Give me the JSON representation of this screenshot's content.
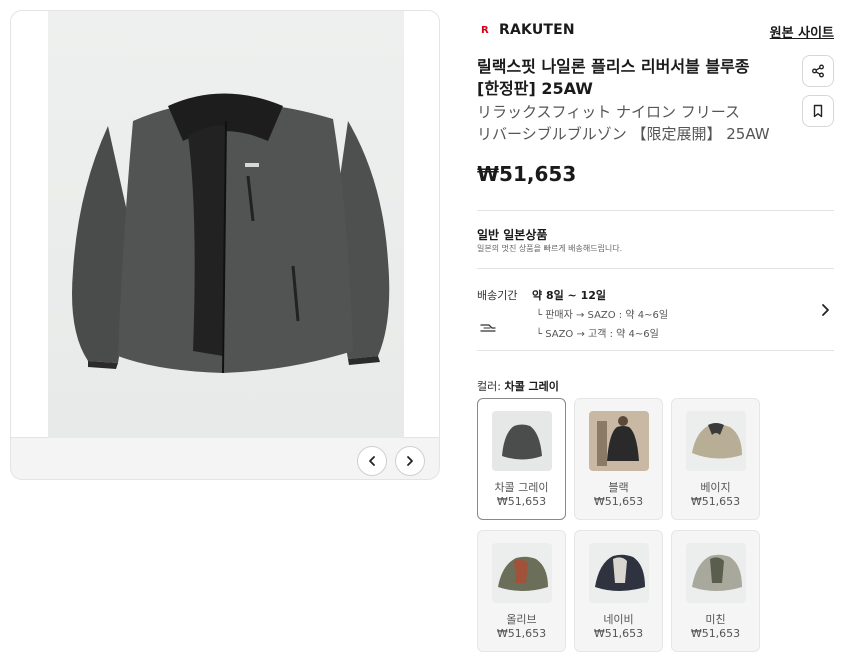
{
  "gallery": {
    "prev_icon": "chevron-left-icon",
    "next_icon": "chevron-right-icon"
  },
  "product": {
    "brand": "RAKUTEN",
    "brand_logo": "R",
    "brand_color": "#d0021b",
    "origin_link": "원본 사이트",
    "title_line1": "릴랙스핏 나일론 플리스 리버서블 블루종",
    "title_line2": "[한정판] 25AW",
    "subtitle_line1": "リラックスフィット ナイロン フリース",
    "subtitle_line2": "リバーシブルブルゾン 【限定展開】 25AW",
    "price": "₩51,653"
  },
  "seller": {
    "type_title": "일반 일본상품",
    "type_desc": "일본의 멋진 상품을 빠르게 배송해드립니다."
  },
  "shipping": {
    "label": "배송기간",
    "value": "약 8일 ~ 12일",
    "route1": "└ 판매자 → SAZO : 약 4~6일",
    "route2": "└ SAZO → 고객 : 약 4~6일"
  },
  "colors": {
    "label_prefix": "컬러: ",
    "selected_name": "차콜 그레이",
    "options": [
      {
        "name": "차콜 그레이",
        "price": "₩51,653",
        "tone": "#4b4d4d"
      },
      {
        "name": "블랙",
        "price": "₩51,653",
        "tone": "#2a2a2a"
      },
      {
        "name": "베이지",
        "price": "₩51,653",
        "tone": "#b7ae95"
      },
      {
        "name": "올리브",
        "price": "₩51,653",
        "tone": "#6b6e58"
      },
      {
        "name": "네이비",
        "price": "₩51,653",
        "tone": "#2f3340"
      },
      {
        "name": "미친",
        "price": "₩51,653",
        "tone": "#a9a89d"
      }
    ]
  }
}
